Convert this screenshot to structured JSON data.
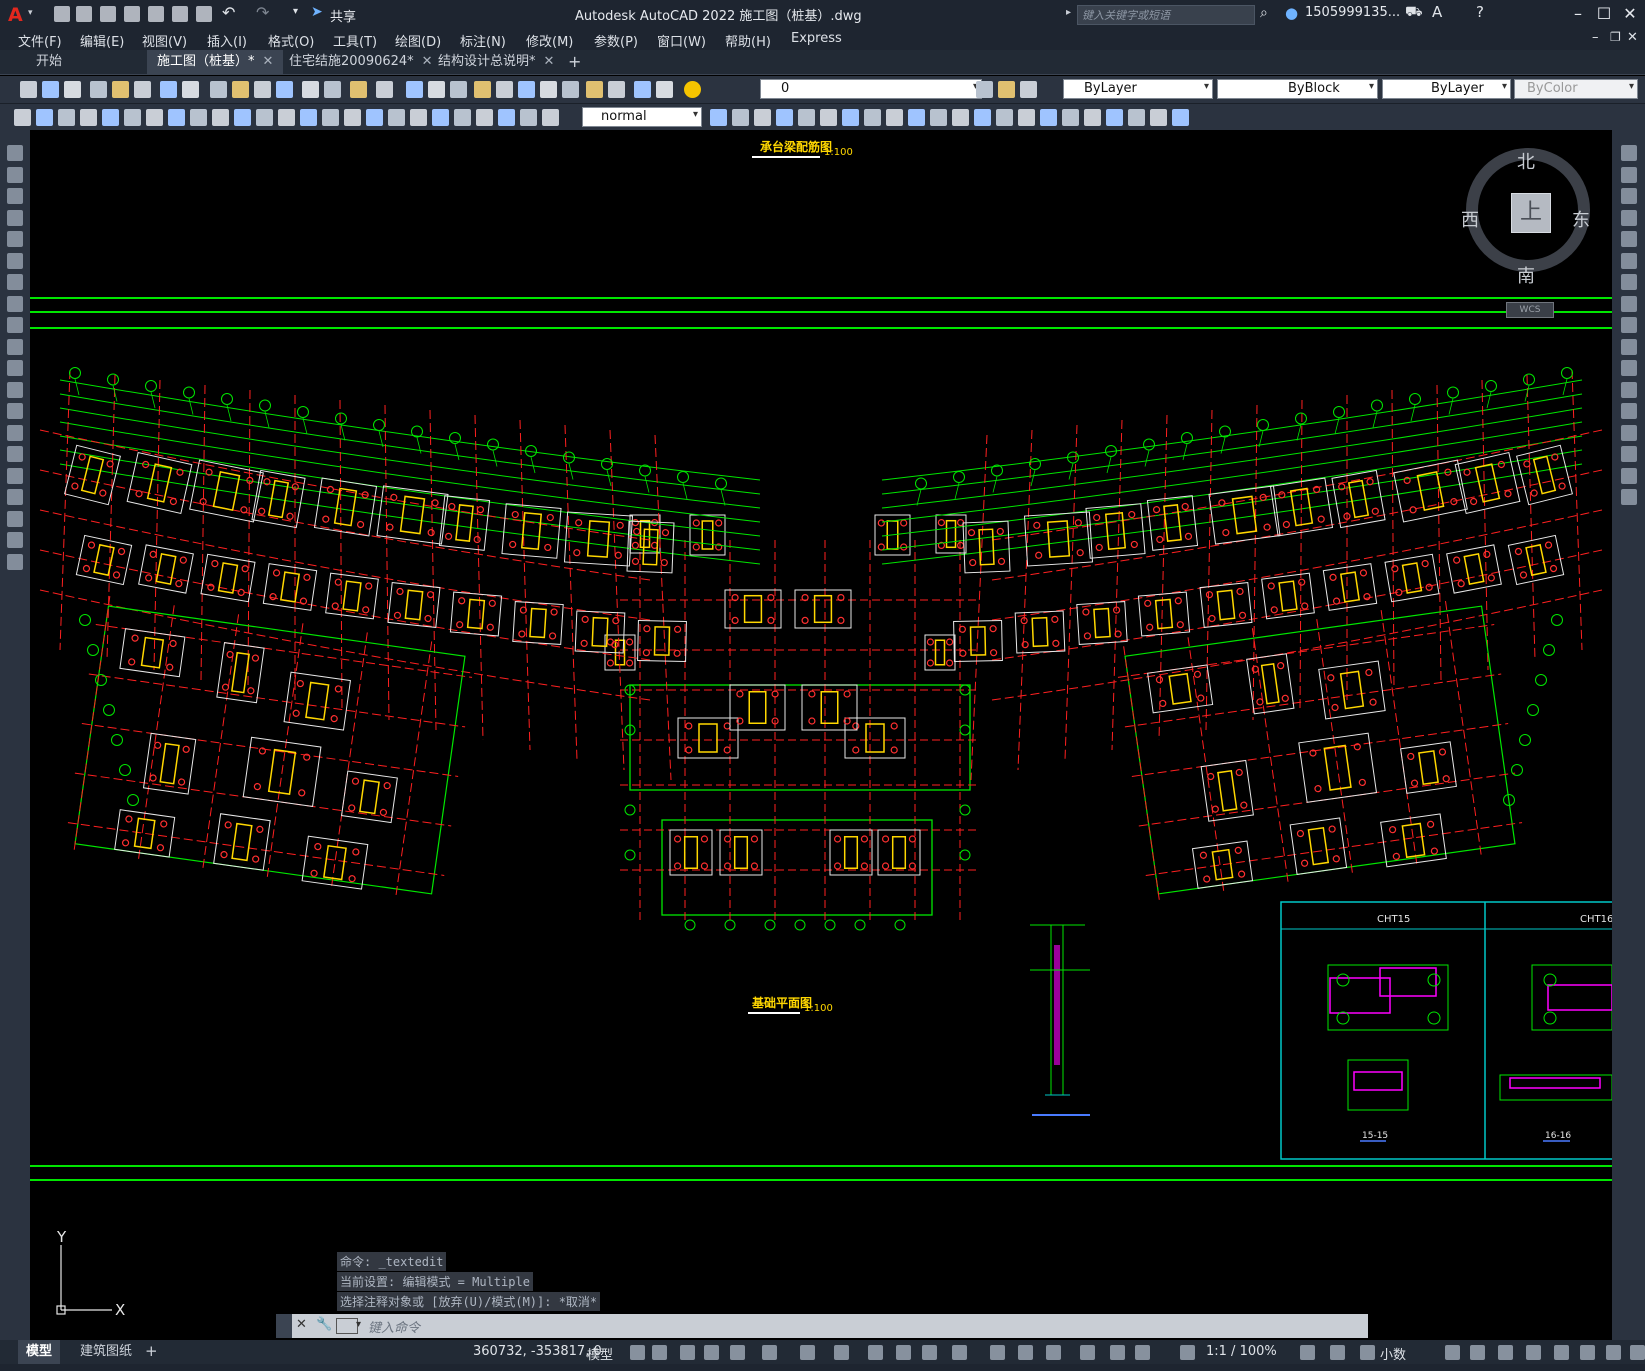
{
  "app": {
    "title": "Autodesk AutoCAD 2022    施工图（桩基）.dwg",
    "share_label": "共享",
    "search_placeholder": "键入关键字或短语",
    "user": "1505999135...",
    "logo": "A"
  },
  "menu": [
    "文件(F)",
    "编辑(E)",
    "视图(V)",
    "插入(I)",
    "格式(O)",
    "工具(T)",
    "绘图(D)",
    "标注(N)",
    "修改(M)",
    "参数(P)",
    "窗口(W)",
    "帮助(H)",
    "Express"
  ],
  "tabs": [
    {
      "label": "开始",
      "active": false,
      "closable": false
    },
    {
      "label": "施工图（桩基）*",
      "active": true,
      "closable": true
    },
    {
      "label": "住宅结施20090624*",
      "active": false,
      "closable": true
    },
    {
      "label": "结构设计总说明*",
      "active": false,
      "closable": true
    }
  ],
  "toolbar": {
    "layer_value": "0",
    "color_value": "ByLayer",
    "linetype_value": "ByBlock",
    "lineweight_value": "ByLayer",
    "plotstyle_value": "ByColor",
    "dimstyle_value": "normal"
  },
  "viewcube": {
    "top": "上",
    "north": "北",
    "south": "南",
    "east": "东",
    "west": "西",
    "wcs": "WCS"
  },
  "drawing": {
    "title_top": "承台梁配筋图",
    "title_top_scale": "1:100",
    "title_plan": "基础平面图",
    "title_plan_scale": "1:100",
    "detail_a": "CHT15",
    "detail_b": "CHT16",
    "section_a": "15-15",
    "section_b": "16-16",
    "ucs_y": "Y",
    "ucs_x": "X"
  },
  "command": {
    "history": [
      "命令: _textedit",
      "当前设置: 编辑模式 = Multiple",
      "选择注释对象或 [放弃(U)/模式(M)]: *取消*"
    ],
    "placeholder": "键入命令"
  },
  "layout_tabs": [
    "模型",
    "建筑图纸"
  ],
  "status": {
    "coords": "360732, -353817, 0",
    "space": "模型",
    "scale": "1:1 / 100%",
    "units": "小数"
  },
  "colors": {
    "grid_green": "#00e600",
    "axis_red": "#ff2020",
    "column_yellow": "#ffd700",
    "pile_red": "#ff3030",
    "frame_cyan": "#00c8c8",
    "magenta": "#ff00ff"
  }
}
